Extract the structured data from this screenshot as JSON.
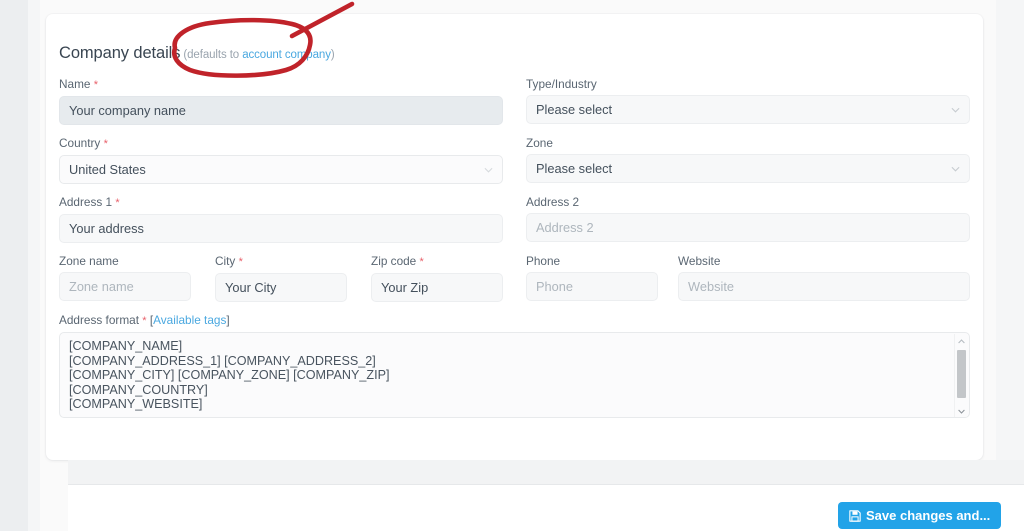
{
  "card": {
    "title": "Company details",
    "title_note_prefix": "(defaults to ",
    "title_note_link": "account company",
    "title_note_suffix": ")"
  },
  "form": {
    "name": {
      "label": "Name",
      "required": "*",
      "value": "Your company name"
    },
    "type_industry": {
      "label": "Type/Industry",
      "value": "Please select",
      "icon": "chevron-down-icon"
    },
    "country": {
      "label": "Country",
      "required": "*",
      "value": "United States",
      "icon": "chevron-down-icon"
    },
    "zone": {
      "label": "Zone",
      "value": "Please select",
      "icon": "chevron-down-icon"
    },
    "address1": {
      "label": "Address 1",
      "required": "*",
      "value": "Your address"
    },
    "address2": {
      "label": "Address 2",
      "placeholder": "Address 2"
    },
    "zone_name": {
      "label": "Zone name",
      "placeholder": "Zone name"
    },
    "city": {
      "label": "City",
      "required": "*",
      "value": "Your City"
    },
    "zip_code": {
      "label": "Zip code",
      "required": "*",
      "value": "Your Zip"
    },
    "phone": {
      "label": "Phone",
      "placeholder": "Phone"
    },
    "website": {
      "label": "Website",
      "placeholder": "Website"
    },
    "address_format": {
      "label": "Address format",
      "required": "*",
      "bracket_open": "[",
      "link": "Available tags",
      "bracket_close": "]",
      "value": "[COMPANY_NAME]\n[COMPANY_ADDRESS_1] [COMPANY_ADDRESS_2]\n[COMPANY_CITY] [COMPANY_ZONE] [COMPANY_ZIP]\n[COMPANY_COUNTRY]\n[COMPANY_WEBSITE]"
    }
  },
  "footer": {
    "save_label": "Save changes and...",
    "save_icon": "floppy-disk-icon"
  },
  "annotation": {
    "type": "hand-drawn-ellipse-with-pointer",
    "color": "#c0232a",
    "target": "account company"
  },
  "colors": {
    "accent_blue": "#22a3e8",
    "link_blue": "#4aa8e0",
    "required_red": "#e8606a",
    "annotation_red": "#c0232a",
    "page_bg": "#eceef0",
    "card_bg": "#ffffff"
  }
}
